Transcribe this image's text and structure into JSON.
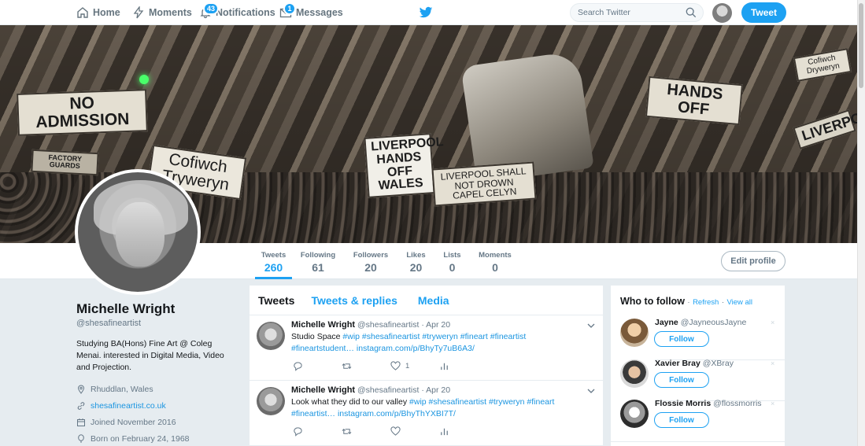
{
  "nav": {
    "home": "Home",
    "moments": "Moments",
    "notifications": "Notifications",
    "notifications_badge": "43",
    "messages": "Messages",
    "messages_badge": "1",
    "search_placeholder": "Search Twitter",
    "tweet_button": "Tweet"
  },
  "banner": {
    "signs": [
      "NO ADMISSION",
      "Cofiwch Tryweryn",
      "HANDS OFF",
      "LIVERPOOL HANDS OFF WALES",
      "LIVERPOOL SHALL NOT DROWN CAPEL CELYN",
      "HANDS OFF",
      "LIVERPOOL",
      "FACTORY GUARDS",
      "Cofiwch Dryweryn"
    ]
  },
  "stats": [
    {
      "label": "Tweets",
      "value": "260"
    },
    {
      "label": "Following",
      "value": "61"
    },
    {
      "label": "Followers",
      "value": "20"
    },
    {
      "label": "Likes",
      "value": "20"
    },
    {
      "label": "Lists",
      "value": "0"
    },
    {
      "label": "Moments",
      "value": "0"
    }
  ],
  "edit_profile": "Edit profile",
  "profile": {
    "name": "Michelle Wright",
    "handle": "@shesafineartist",
    "bio": "Studying BA(Hons) Fine Art @ Coleg Menai. interested in Digital Media, Video and Projection.",
    "location": "Rhuddlan, Wales",
    "website": "shesafineartist.co.uk",
    "joined": "Joined November 2016",
    "born": "Born on February 24, 1968"
  },
  "timeline": {
    "tabs": [
      "Tweets",
      "Tweets & replies",
      "Media"
    ],
    "tweets": [
      {
        "name": "Michelle Wright",
        "handle": "@shesafineartist",
        "date": "· Apr 20",
        "text_plain": "Studio Space ",
        "hashtags": "#wip #shesafineartist #tryweryn #fineart #fineartist #fineartstudent…",
        "link": "instagram.com/p/BhyTy7uB6A3/",
        "likes": "1"
      },
      {
        "name": "Michelle Wright",
        "handle": "@shesafineartist",
        "date": "· Apr 20",
        "text_plain": "Look what they did to our valley ",
        "hashtags": "#wip #shesafineartist #tryweryn #fineart #fineartist…",
        "link": "instagram.com/p/BhyThYXBI7T/",
        "likes": ""
      }
    ]
  },
  "who_to_follow": {
    "title": "Who to follow",
    "refresh": "Refresh",
    "separator": "·",
    "view_all": "View all",
    "follow_label": "Follow",
    "close": "×",
    "users": [
      {
        "name": "Jayne",
        "handle": "@JayneousJayne"
      },
      {
        "name": "Xavier Bray",
        "handle": "@XBray"
      },
      {
        "name": "Flossie Morris",
        "handle": "@flossmorris"
      }
    ]
  },
  "colors": {
    "accent": "#1da1f2",
    "link": "#1b95e0",
    "background": "#e6ecf0",
    "muted": "#657786"
  }
}
